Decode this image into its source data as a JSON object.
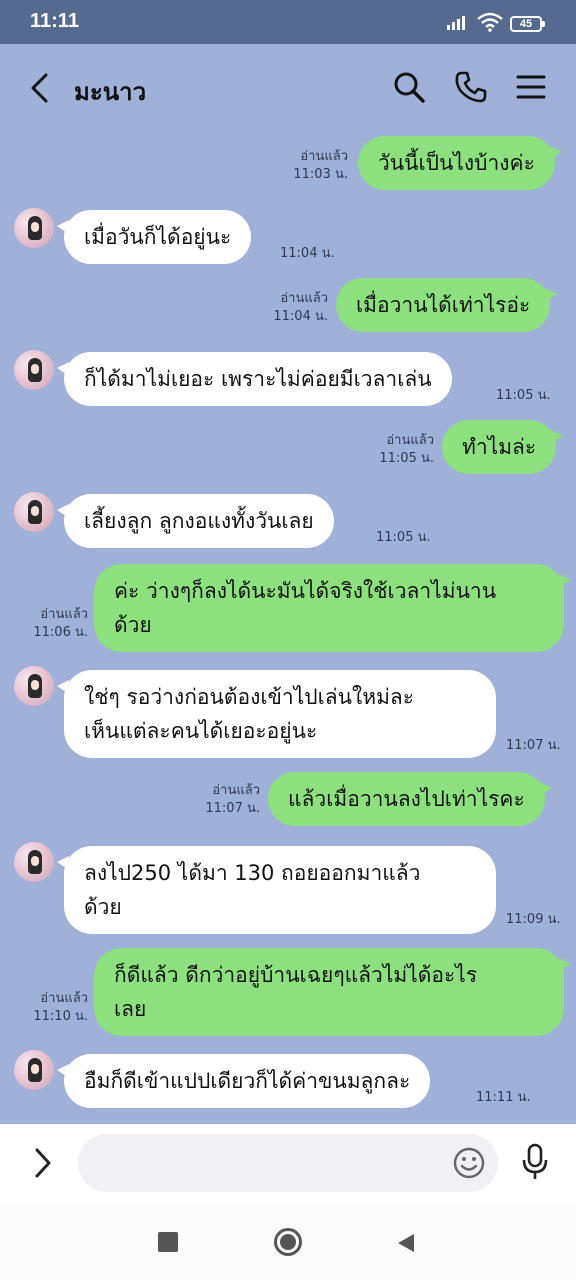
{
  "status_bar": {
    "time": "11:11",
    "battery": "45"
  },
  "header": {
    "title": "มะนาว"
  },
  "messages": [
    {
      "side": "out",
      "text": "วันนี้เป็นไงบ้างค่ะ",
      "read": "อ่านแล้ว",
      "time": "11:03 น."
    },
    {
      "side": "in",
      "text": "เมื่อวันก็ได้อยู่นะ",
      "time": "11:04 น."
    },
    {
      "side": "out",
      "text": "เมื่อวานได้เท่าไรอ่ะ",
      "read": "อ่านแล้ว",
      "time": "11:04 น."
    },
    {
      "side": "in",
      "text": "ก็ได้มาไม่เยอะ เพราะไม่ค่อยมีเวลาเล่น",
      "time": "11:05 น."
    },
    {
      "side": "out",
      "text": "ทำไมล่ะ",
      "read": "อ่านแล้ว",
      "time": "11:05 น."
    },
    {
      "side": "in",
      "text": "เลี้ยงลูก ลูกงอแงทั้งวันเลย",
      "time": "11:05 น."
    },
    {
      "side": "out",
      "text_lines": [
        "ค่ะ ว่างๆก็ลงได้นะมันได้จริงใช้เวลาไม่นาน",
        "ด้วย"
      ],
      "read": "อ่านแล้ว",
      "time": "11:06 น."
    },
    {
      "side": "in",
      "text_lines": [
        "ใช่ๆ รอว่างก่อนต้องเข้าไปเล่นใหม่ละ",
        "เห็นแต่ละคนได้เยอะอยู่นะ"
      ],
      "time": "11:07 น."
    },
    {
      "side": "out",
      "text": "แล้วเมื่อวานลงไปเท่าไรคะ",
      "read": "อ่านแล้ว",
      "time": "11:07 น."
    },
    {
      "side": "in",
      "text_lines": [
        "ลงไป250  ได้มา 130 ถอยออกมาแล้ว",
        "ด้วย"
      ],
      "time": "11:09 น."
    },
    {
      "side": "out",
      "text_lines": [
        "ก็ดีแล้ว ดีกว่าอยู่บ้านเฉยๆแล้วไม่ได้อะไร",
        "เลย"
      ],
      "read": "อ่านแล้ว",
      "time": "11:10 น."
    },
    {
      "side": "in",
      "text": "อืมก็ดีเข้าแปปเดียวก็ได้ค่าขนมลูกละ",
      "time": "11:11 น."
    }
  ],
  "input": {
    "placeholder": ""
  },
  "colors": {
    "background": "#9fb0d9",
    "outgoing": "#8de07e",
    "incoming": "#ffffff",
    "status_bar": "#56698e"
  },
  "icons": [
    "back-icon",
    "search-icon",
    "phone-icon",
    "menu-icon",
    "expand-icon",
    "emoji-icon",
    "mic-icon"
  ]
}
